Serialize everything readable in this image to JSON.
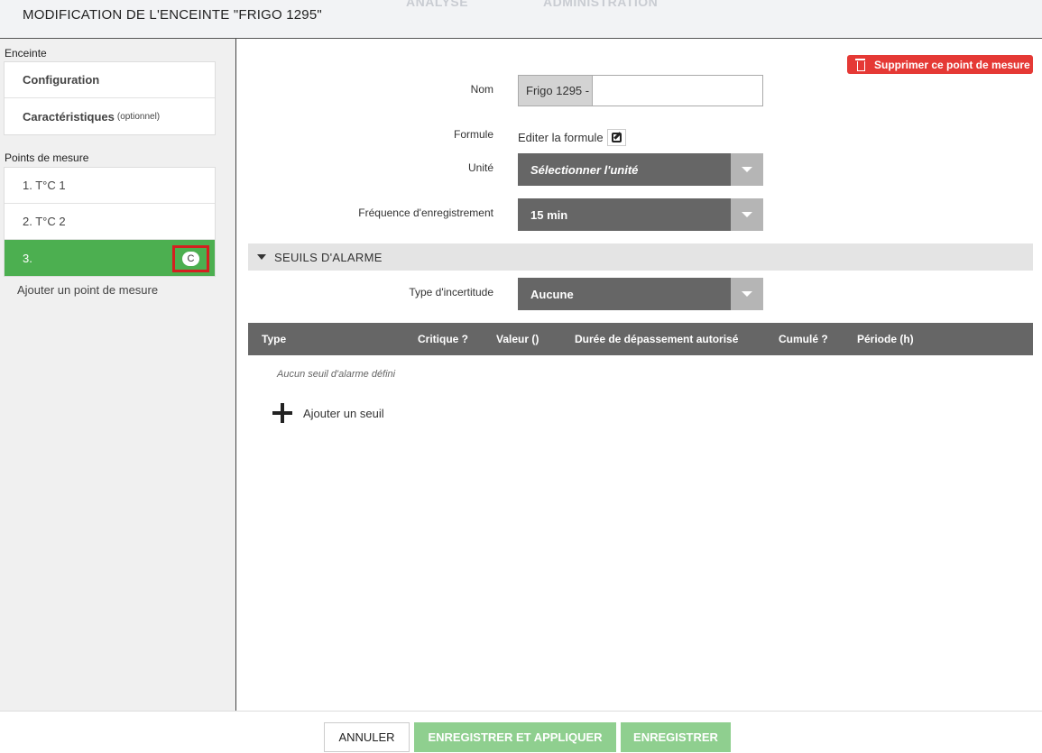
{
  "header": {
    "title": "MODIFICATION DE L'ENCEINTE \"FRIGO 1295\"",
    "bg_nav": [
      "ANALYSE",
      "ADMINISTRATION"
    ]
  },
  "sidebar": {
    "section1_label": "Enceinte",
    "config_label": "Configuration",
    "caract_label": "Caractéristiques",
    "caract_suffix": "(optionnel)",
    "section2_label": "Points de mesure",
    "points": [
      {
        "label": "1. T°C 1"
      },
      {
        "label": "2. T°C 2"
      },
      {
        "label": "3.",
        "badge": "C"
      }
    ],
    "add_point": "Ajouter un point de mesure"
  },
  "form": {
    "delete_button": "Supprimer ce point de mesure",
    "nom_label": "Nom",
    "nom_prefix": "Frigo 1295 -",
    "nom_value": "",
    "formule_label": "Formule",
    "formule_link": "Editer la formule",
    "unite_label": "Unité",
    "unite_value": "Sélectionner l'unité",
    "frequence_label": "Fréquence d'enregistrement",
    "frequence_value": "15 min"
  },
  "alarm": {
    "section_title": "SEUILS D'ALARME",
    "type_incertitude_label": "Type d'incertitude",
    "type_incertitude_value": "Aucune",
    "columns": [
      "Type",
      "Critique ?",
      "Valeur ()",
      "Durée de dépassement autorisé",
      "Cumulé ?",
      "Période (h)"
    ],
    "empty_text": "Aucun seuil d'alarme défini",
    "add_label": "Ajouter un seuil"
  },
  "footer": {
    "cancel": "ANNULER",
    "save_apply": "ENREGISTRER ET APPLIQUER",
    "save": "ENREGISTRER"
  },
  "colors": {
    "active_green": "#4caf50",
    "danger_red": "#e53935",
    "select_grey": "#666666",
    "button_green": "#8fcf8f"
  }
}
